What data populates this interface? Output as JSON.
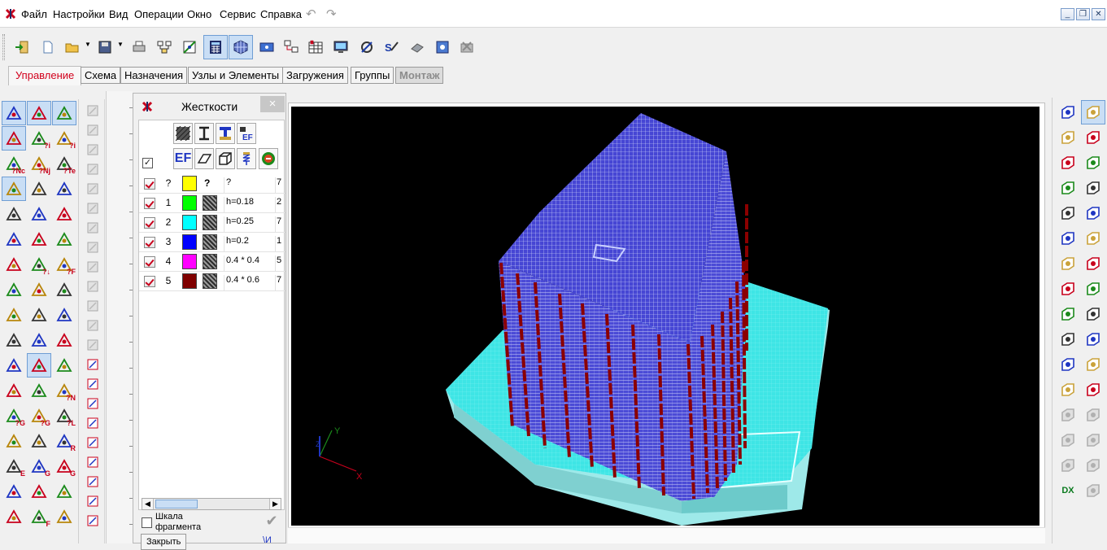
{
  "menu": {
    "items": [
      "Файл",
      "Настройки",
      "Вид",
      "Операции",
      "Окно",
      "Сервис",
      "Справка"
    ],
    "undo_icon": "undo-icon",
    "redo_icon": "redo-icon",
    "window_buttons": [
      "minimize",
      "restore",
      "close"
    ]
  },
  "toolbar": {
    "icons": [
      "exit-icon",
      "new-file-icon",
      "open-folder-icon",
      "save-icon",
      "print-icon",
      "network-icon",
      "model-edit-icon",
      "grid-calc-icon",
      "mesh-icon",
      "display-icon",
      "scheme-tree-icon",
      "table-icon",
      "monitor-icon",
      "settings-icon",
      "solve-icon",
      "results-icon",
      "config-icon",
      "analysis-icon"
    ],
    "active_icons": [
      "grid-calc-icon",
      "mesh-icon"
    ]
  },
  "tabs": [
    {
      "label": "Управление",
      "state": "active"
    },
    {
      "label": "Схема",
      "state": "normal"
    },
    {
      "label": "Назначения",
      "state": "normal"
    },
    {
      "label": "Узлы и Элементы",
      "state": "normal"
    },
    {
      "label": "Загружения",
      "state": "normal"
    },
    {
      "label": "Группы",
      "state": "normal"
    },
    {
      "label": "Монтаж",
      "state": "disabled"
    }
  ],
  "left_tools": {
    "row_labels": [
      [
        "",
        "",
        ""
      ],
      [
        "",
        "?i",
        "?i"
      ],
      [
        "?Nc",
        "?Nj",
        "?Te"
      ],
      [
        "",
        "",
        ""
      ],
      [
        "",
        "",
        ""
      ],
      [
        "",
        "",
        ""
      ],
      [
        "",
        "?↓",
        "?F"
      ],
      [
        "",
        "",
        ""
      ],
      [
        "",
        "",
        ""
      ],
      [
        "",
        "",
        ""
      ],
      [
        "",
        "",
        ""
      ],
      [
        "",
        "",
        "?N"
      ],
      [
        "?G",
        "?G",
        "?L"
      ],
      [
        "",
        "",
        "R"
      ],
      [
        "E",
        "G",
        "G"
      ],
      [
        "",
        "",
        ""
      ],
      [
        "",
        "F",
        ""
      ]
    ]
  },
  "stiffness_panel": {
    "title": "Жесткости",
    "close_label": "×",
    "header_icons_row1": [
      "plate-hatch-icon",
      "i-beam-icon",
      "i-beam-blue-icon",
      "ef-small-icon"
    ],
    "header_icons_row2": [
      "ef-icon",
      "plate-icon",
      "box-icon",
      "spring-icon",
      "cancel-round-icon"
    ],
    "rows": [
      {
        "number": "?",
        "color": "#ffff00",
        "desc": "?",
        "extra": "7",
        "hatch": false
      },
      {
        "number": "1",
        "color": "#00ff00",
        "desc": "h=0.18",
        "extra": "2",
        "hatch": true
      },
      {
        "number": "2",
        "color": "#00ffff",
        "desc": "h=0.25",
        "extra": "7",
        "hatch": true
      },
      {
        "number": "3",
        "color": "#0000ff",
        "desc": "h=0.2",
        "extra": "1",
        "hatch": true
      },
      {
        "number": "4",
        "color": "#ff00ff",
        "desc": "0.4 * 0.4",
        "extra": "5",
        "hatch": true
      },
      {
        "number": "5",
        "color": "#800000",
        "desc": "0.4 * 0.6",
        "extra": "7",
        "hatch": true
      }
    ],
    "scale_label_line1": "Шкала",
    "scale_label_line2": "фрагмента",
    "close_button": "Закрыть",
    "ok_label": "\\И"
  },
  "viewport": {
    "background": "#000000",
    "axis_labels": {
      "x": "X",
      "y": "Y",
      "z": "Z"
    },
    "building_colors": {
      "slab": "#4848d8",
      "mesh": "#ffffff",
      "column": "#8b0000",
      "foundation": "#3fe6e6"
    }
  },
  "right_tools": {
    "labels": [
      "",
      "",
      "",
      "",
      "",
      "",
      "",
      "",
      "",
      "",
      "",
      "",
      "",
      "",
      "",
      "",
      "",
      "",
      "",
      "",
      "",
      "",
      "",
      "",
      "",
      "",
      "",
      "",
      "",
      "",
      "DX"
    ]
  },
  "colors": {
    "accent": "#c8001c",
    "selected_bg": "#c9def5",
    "selected_border": "#6f9ed4"
  }
}
